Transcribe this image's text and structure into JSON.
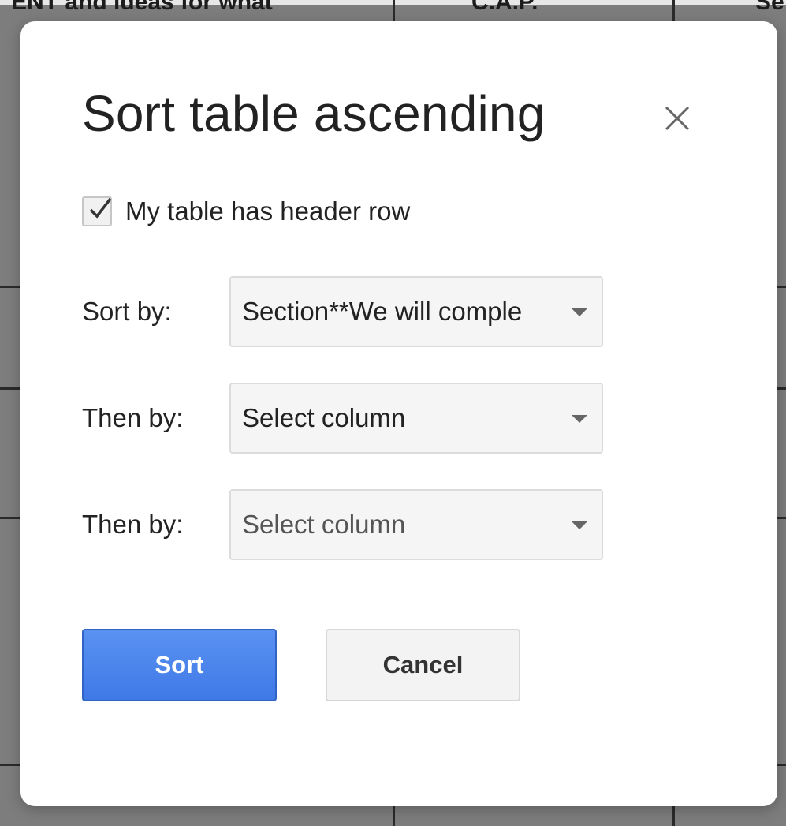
{
  "background": {
    "text_fragments": [
      "ENT and ideas for what",
      "C.A.P.",
      "Se"
    ]
  },
  "dialog": {
    "title": "Sort table ascending",
    "close_icon": "close-icon",
    "header_checkbox": {
      "label": "My table has header row",
      "checked": true
    },
    "sort_by": {
      "label": "Sort by:",
      "value": "Section**We will comple"
    },
    "then_by_1": {
      "label": "Then by:",
      "value": "Select column"
    },
    "then_by_2": {
      "label": "Then by:",
      "value": "Select column"
    },
    "buttons": {
      "sort": "Sort",
      "cancel": "Cancel"
    },
    "colors": {
      "primary": "#4a86e8",
      "dialog_bg": "#ffffff"
    }
  }
}
